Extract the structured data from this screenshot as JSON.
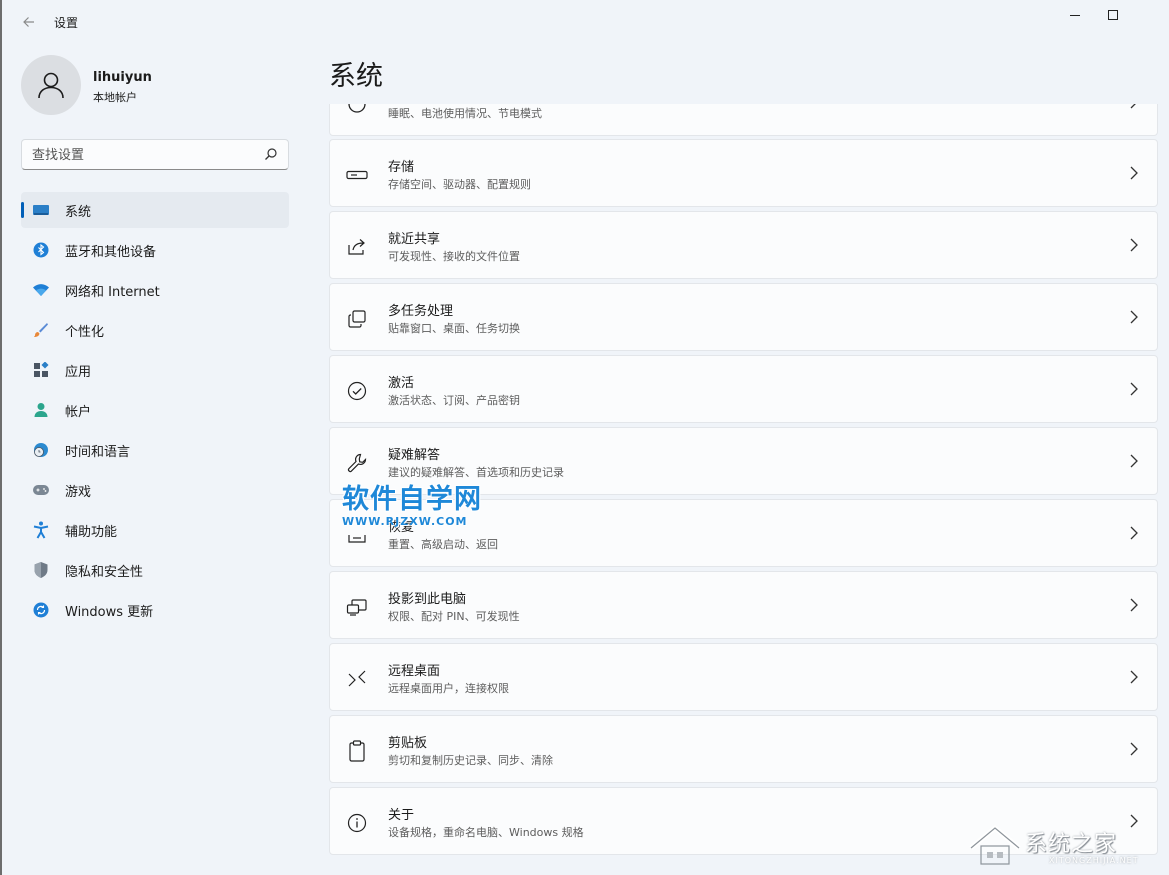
{
  "window": {
    "title": "设置"
  },
  "user": {
    "name": "lihuiyun",
    "account_type": "本地帐户"
  },
  "search": {
    "placeholder": "查找设置"
  },
  "sidebar": {
    "items": [
      {
        "label": "系统",
        "icon": "system-icon",
        "active": true
      },
      {
        "label": "蓝牙和其他设备",
        "icon": "bluetooth-icon"
      },
      {
        "label": "网络和 Internet",
        "icon": "wifi-icon"
      },
      {
        "label": "个性化",
        "icon": "brush-icon"
      },
      {
        "label": "应用",
        "icon": "apps-icon"
      },
      {
        "label": "帐户",
        "icon": "person-icon"
      },
      {
        "label": "时间和语言",
        "icon": "globe-clock-icon"
      },
      {
        "label": "游戏",
        "icon": "gamepad-icon"
      },
      {
        "label": "辅助功能",
        "icon": "accessibility-icon"
      },
      {
        "label": "隐私和安全性",
        "icon": "shield-icon"
      },
      {
        "label": "Windows 更新",
        "icon": "update-icon"
      }
    ]
  },
  "main": {
    "title": "系统",
    "rows": [
      {
        "title": "",
        "subtitle": "睡眠、电池使用情况、节电模式",
        "icon": "power-icon"
      },
      {
        "title": "存储",
        "subtitle": "存储空间、驱动器、配置规则",
        "icon": "storage-icon"
      },
      {
        "title": "就近共享",
        "subtitle": "可发现性、接收的文件位置",
        "icon": "share-icon"
      },
      {
        "title": "多任务处理",
        "subtitle": "贴靠窗口、桌面、任务切换",
        "icon": "multitask-icon"
      },
      {
        "title": "激活",
        "subtitle": "激活状态、订阅、产品密钥",
        "icon": "check-circle-icon"
      },
      {
        "title": "疑难解答",
        "subtitle": "建议的疑难解答、首选项和历史记录",
        "icon": "wrench-icon"
      },
      {
        "title": "恢复",
        "subtitle": "重置、高级启动、返回",
        "icon": "recovery-icon"
      },
      {
        "title": "投影到此电脑",
        "subtitle": "权限、配对 PIN、可发现性",
        "icon": "project-icon"
      },
      {
        "title": "远程桌面",
        "subtitle": "远程桌面用户，连接权限",
        "icon": "remote-desktop-icon"
      },
      {
        "title": "剪贴板",
        "subtitle": "剪切和复制历史记录、同步、清除",
        "icon": "clipboard-icon"
      },
      {
        "title": "关于",
        "subtitle": "设备规格，重命名电脑、Windows 规格",
        "icon": "info-icon"
      }
    ]
  },
  "watermarks": {
    "site1_title": "软件自学网",
    "site1_url": "WWW.RJZXW.COM",
    "site2_title": "系统之家",
    "site2_url": "XITONGZHIJIA.NET"
  },
  "colors": {
    "accent": "#005fb8",
    "background": "#f0f4f9",
    "card": "#fbfcfd"
  }
}
